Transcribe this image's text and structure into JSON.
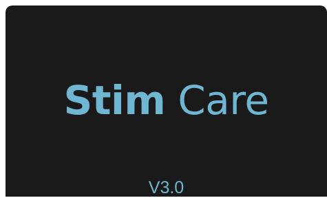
{
  "splash": {
    "logo_bold": "Stim",
    "logo_light": "Care",
    "version": "V3.0"
  },
  "colors": {
    "background": "#1a1a1a",
    "accent": "#6fb6d2"
  }
}
